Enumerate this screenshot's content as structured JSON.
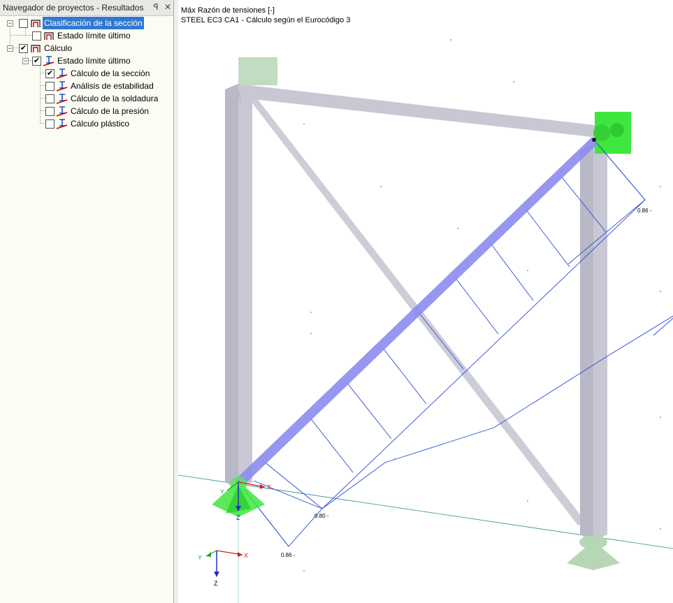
{
  "navigator": {
    "title": "Navegador de proyectos - Resultados",
    "pin_icon": "ꟼ",
    "close_icon": "✕",
    "items": [
      {
        "label": "Clasificación de la sección",
        "checked": false,
        "selected": true
      },
      {
        "label": "Estado límite último",
        "checked": false
      },
      {
        "label": "Cálculo",
        "checked": true
      },
      {
        "label": "Estado límite último",
        "checked": true
      },
      {
        "label": "Cálculo de la sección",
        "checked": true
      },
      {
        "label": "Análisis de estabilidad",
        "checked": false
      },
      {
        "label": "Cálculo de la soldadura",
        "checked": false
      },
      {
        "label": "Cálculo de la presión",
        "checked": false
      },
      {
        "label": "Cálculo plástico",
        "checked": false
      }
    ]
  },
  "viewport": {
    "title_line1": "Máx Razón de tensiones [-]",
    "title_line2": "STEEL EC3 CA1 - Cálculo según el Eurocódigo 3",
    "result_values": [
      "0.86 -",
      "0.80 -",
      "0.86 -"
    ],
    "axes": {
      "x": "X",
      "y": "Y",
      "z": "Z"
    },
    "colors": {
      "member": "#c8c8d4",
      "diagonal_highlight": "#8c8cf0",
      "result_line": "#2a4bd8",
      "support_active": "#3ee63e",
      "support_inactive": "#b6d6b6",
      "selection": "#3078d0"
    }
  }
}
